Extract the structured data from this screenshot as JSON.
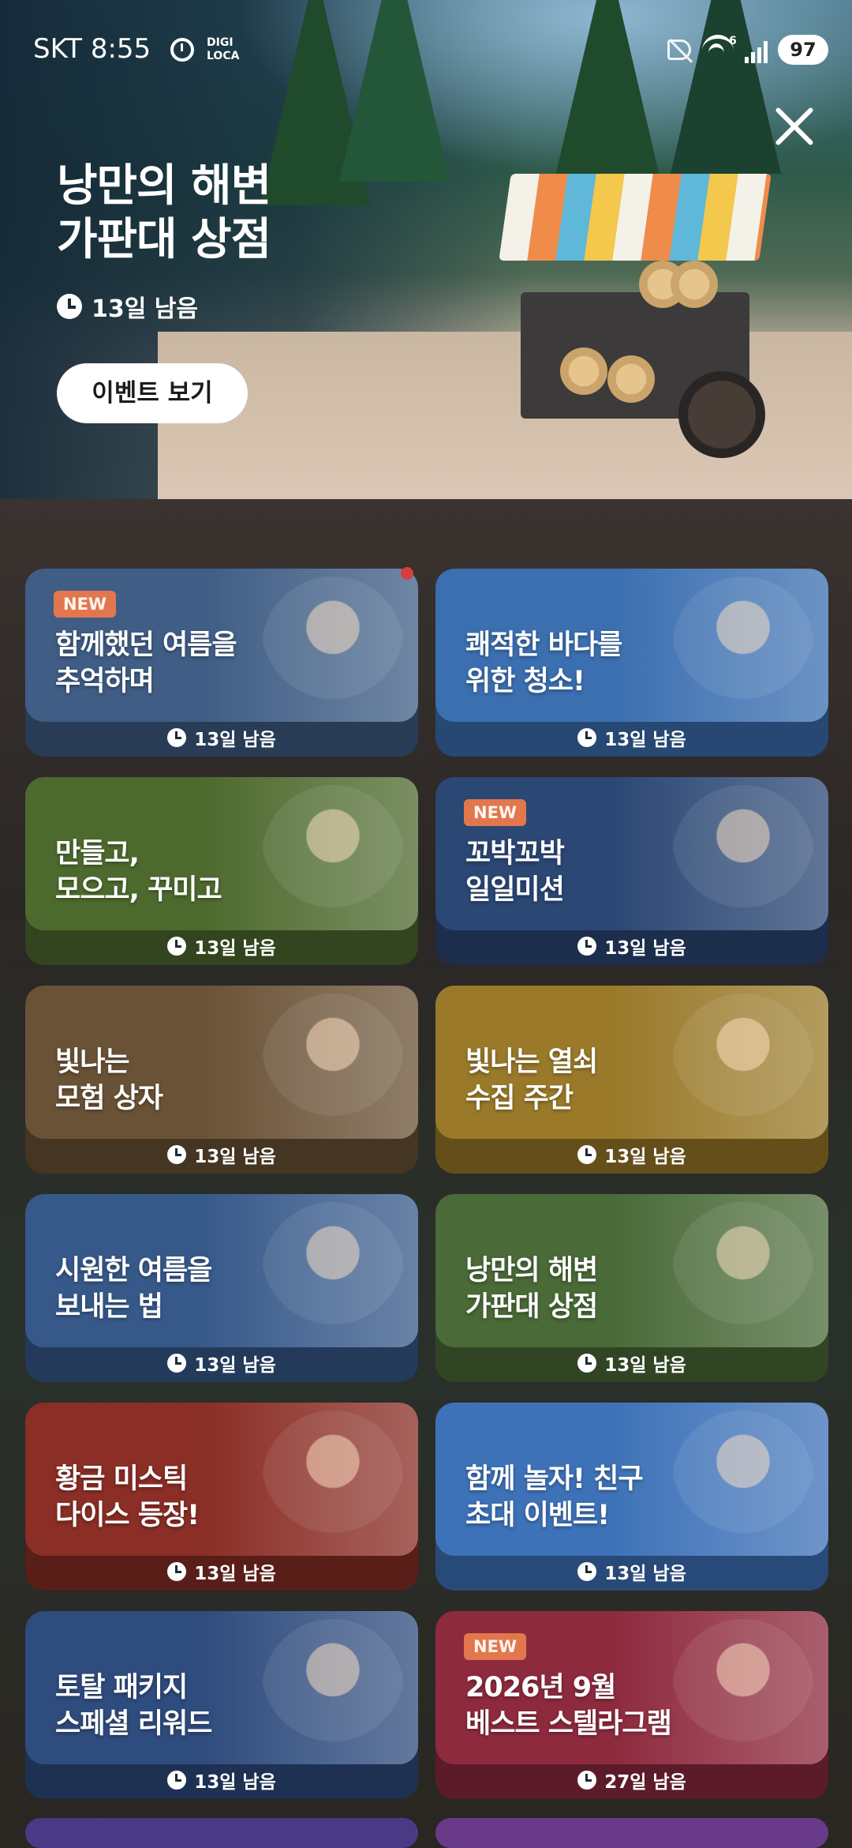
{
  "status_bar": {
    "carrier_time": "SKT 8:55",
    "digi_label": "DIGI\nLOCA",
    "wifi_badge": "6",
    "battery": "97"
  },
  "hero": {
    "title": "낭만의 해변\n가판대 상점",
    "time_left": "13일 남음",
    "button_label": "이벤트 보기"
  },
  "events": [
    {
      "title": "함께했던 여름을\n추억하며",
      "time_left": "13일 남음",
      "new": "NEW",
      "color": "#3f5d85"
    },
    {
      "title": "쾌적한 바다를\n위한 청소!",
      "time_left": "13일 남음",
      "new": "",
      "color": "#3b6fb0"
    },
    {
      "title": "만들고,\n모으고, 꾸미고",
      "time_left": "13일 남음",
      "new": "",
      "color": "#4d6a2e"
    },
    {
      "title": "꼬박꼬박\n일일미션",
      "time_left": "13일 남음",
      "new": "NEW",
      "color": "#2b4774"
    },
    {
      "title": "빛나는\n모험 상자",
      "time_left": "13일 남음",
      "new": "",
      "color": "#6a5236"
    },
    {
      "title": "빛나는 열쇠\n수집 주간",
      "time_left": "13일 남음",
      "new": "",
      "color": "#9a7a2a"
    },
    {
      "title": "시원한 여름을\n보내는 법",
      "time_left": "13일 남음",
      "new": "",
      "color": "#37598a"
    },
    {
      "title": "낭만의 해변\n가판대 상점",
      "time_left": "13일 남음",
      "new": "",
      "color": "#4a6a38"
    },
    {
      "title": "황금 미스틱\n다이스 등장!",
      "time_left": "13일 남음",
      "new": "",
      "color": "#8a2e26"
    },
    {
      "title": "함께 놀자! 친구\n초대 이벤트!",
      "time_left": "13일 남음",
      "new": "",
      "color": "#3e72b8"
    },
    {
      "title": "토탈 패키지\n스페셜 리워드",
      "time_left": "13일 남음",
      "new": "",
      "color": "#2f4c7e"
    },
    {
      "title": "2026년 9월\n베스트 스텔라그램",
      "time_left": "27일 남음",
      "new": "NEW",
      "color": "#8e2a3e"
    }
  ]
}
